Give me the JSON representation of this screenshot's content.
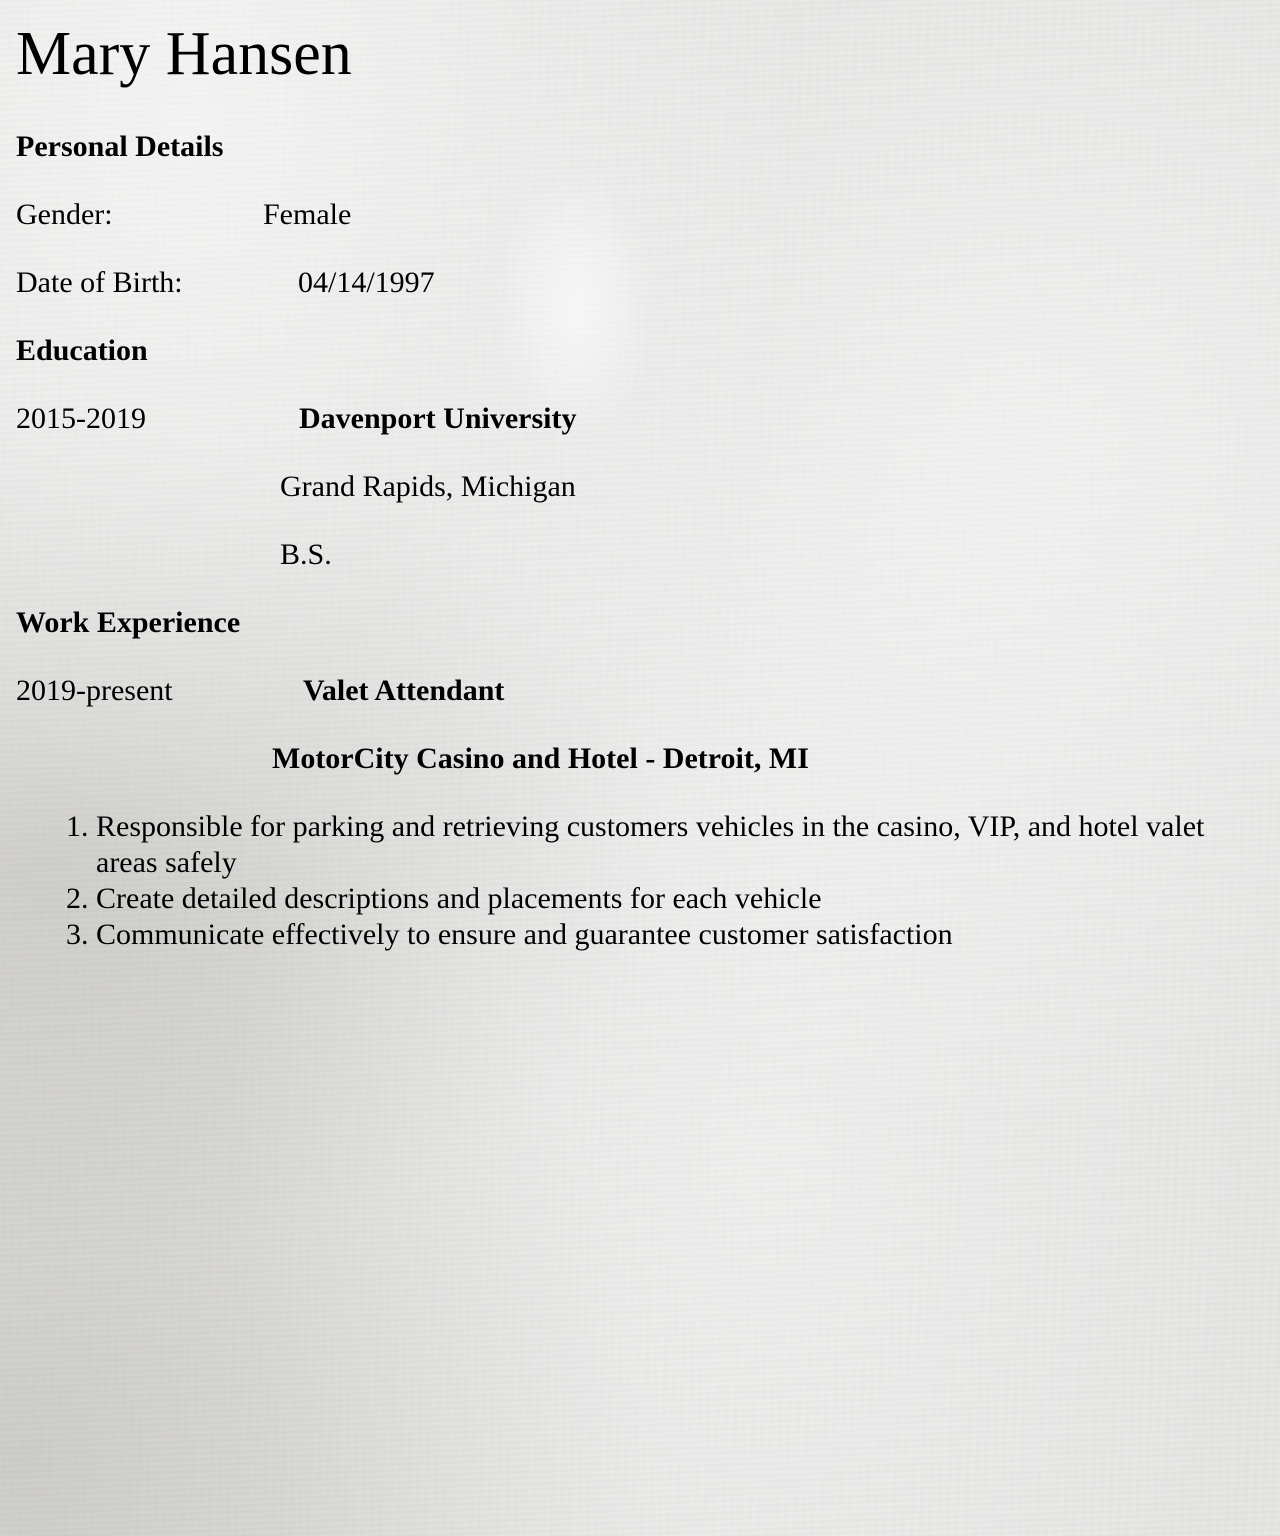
{
  "resume": {
    "name": "Mary Hansen",
    "personal": {
      "heading": "Personal Details",
      "gender_label": "Gender:",
      "gender_value": "Female",
      "dob_label": "Date of Birth:",
      "dob_value": "04/14/1997"
    },
    "education": {
      "heading": "Education",
      "years": "2015-2019",
      "school": "Davenport University",
      "location": "Grand Rapids, Michigan",
      "degree": "B.S."
    },
    "work": {
      "heading": "Work Experience",
      "years": "2019-present",
      "title": "Valet Attendant",
      "employer": "MotorCity Casino and Hotel - Detroit, MI",
      "duties": [
        "Responsible for parking and retrieving customers vehicles in the casino, VIP, and hotel valet areas safely",
        "Create detailed descriptions and placements for each vehicle",
        "Communicate effectively to ensure and guarantee customer satisfaction"
      ]
    }
  }
}
